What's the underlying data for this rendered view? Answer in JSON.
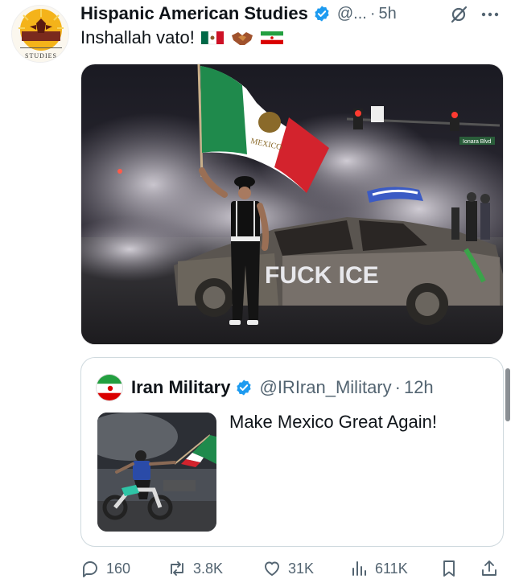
{
  "post": {
    "author_name": "Hispanic American Studies",
    "handle": "@...",
    "separator": "·",
    "time": "5h",
    "text": "Inshallah vato!",
    "emojis": [
      "mexico-flag",
      "handshake",
      "iran-flag"
    ],
    "avatar_text": "STUDIES"
  },
  "media": {
    "flag_text": "MEXICO",
    "car_graffiti": "FUCK ICE",
    "street_sign": "Ionara Blvd"
  },
  "quote": {
    "author_name": "Iran Military",
    "handle": "@IRIran_Military",
    "separator": "·",
    "time": "12h",
    "text": "Make Mexico Great Again!"
  },
  "actions": {
    "replies": "160",
    "reposts": "3.8K",
    "likes": "31K",
    "views": "611K"
  },
  "colors": {
    "verified_blue": "#1d9bf0",
    "secondary_text": "#536471",
    "border": "#cfd9de"
  }
}
